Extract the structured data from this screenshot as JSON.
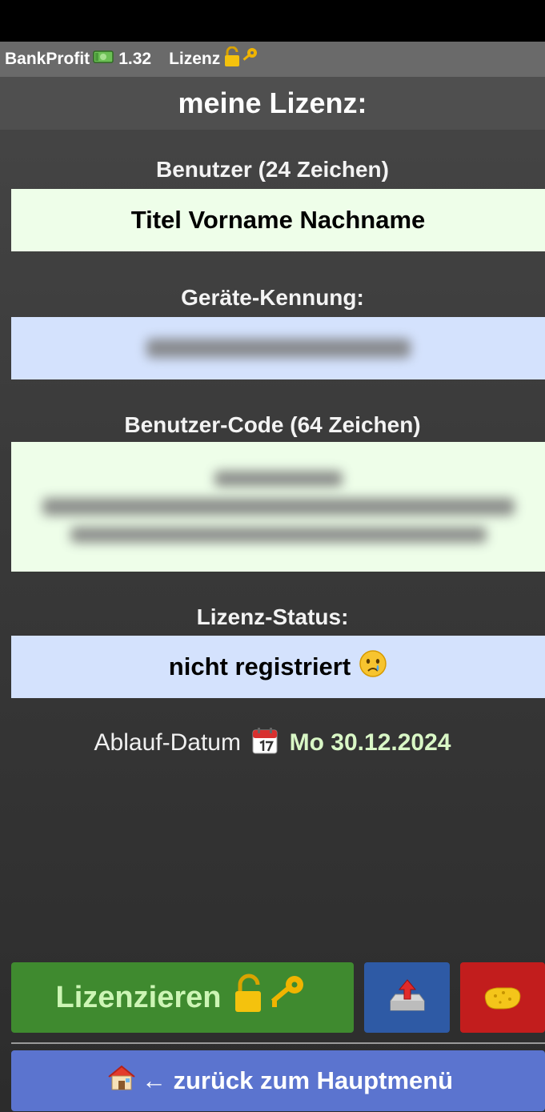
{
  "app": {
    "name": "BankProfit",
    "version": "1.32",
    "section": "Lizenz",
    "heading": "meine Lizenz:"
  },
  "fields": {
    "user_label": "Benutzer (24 Zeichen)",
    "user_value": "Titel Vorname Nachname",
    "device_label": "Geräte-Kennung:",
    "code_label": "Benutzer-Code (64 Zeichen)",
    "status_label": "Lizenz-Status:",
    "status_value": "nicht registriert"
  },
  "expiry": {
    "label": "Ablauf-Datum",
    "date": "Mo 30.12.2024"
  },
  "buttons": {
    "license_label": "Lizenzieren",
    "back_label": "← zurück zum Hauptmenü"
  },
  "icons": {
    "title_money": "money-icon",
    "title_lock": "lock-key-icon",
    "status_emoji": "crying-face-icon",
    "calendar": "calendar-icon",
    "license": "lock-key-icon",
    "upload": "upload-tray-icon",
    "sponge": "sponge-icon",
    "home": "house-icon"
  },
  "colors": {
    "green_field": "#eefee9",
    "blue_field": "#d4e2fd",
    "license_button": "#3f8a2f",
    "upload_button": "#2e5aa5",
    "sponge_button": "#c21d1d",
    "back_button": "#5b74cf"
  }
}
